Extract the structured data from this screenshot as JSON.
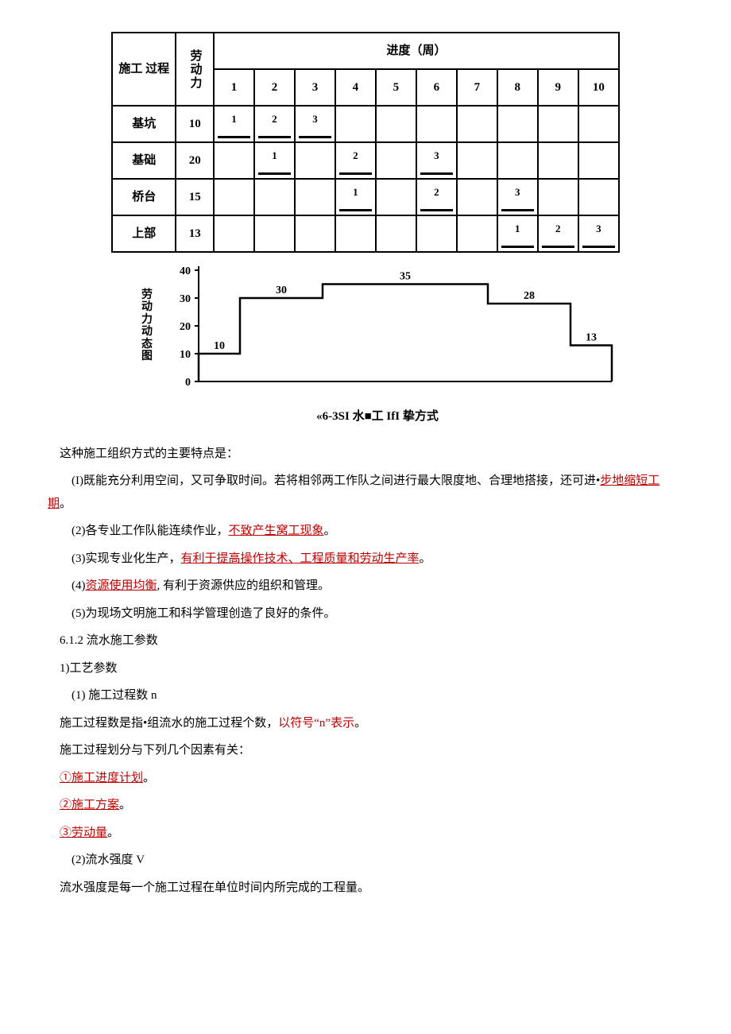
{
  "table": {
    "hdr_process": "施工\n过程",
    "hdr_labor": "劳动力",
    "hdr_progress": "进度（周）",
    "weeks": [
      "1",
      "2",
      "3",
      "4",
      "5",
      "6",
      "7",
      "8",
      "9",
      "10"
    ],
    "rows": [
      {
        "name": "基坑",
        "labor": "10",
        "bars": [
          [
            1,
            "1"
          ],
          [
            2,
            "2"
          ],
          [
            3,
            "3"
          ]
        ]
      },
      {
        "name": "基础",
        "labor": "20",
        "bars": [
          [
            2,
            "1"
          ],
          [
            4,
            "2"
          ],
          [
            6,
            "3"
          ]
        ]
      },
      {
        "name": "桥台",
        "labor": "15",
        "bars": [
          [
            4,
            "1"
          ],
          [
            6,
            "2"
          ],
          [
            8,
            "3"
          ]
        ]
      },
      {
        "name": "上部",
        "labor": "13",
        "bars": [
          [
            8,
            "1"
          ],
          [
            9,
            "2"
          ],
          [
            10,
            "3"
          ]
        ]
      }
    ]
  },
  "chart_data": {
    "type": "bar",
    "ylabel": "劳动力动态图",
    "y_ticks": [
      "40",
      "30",
      "20",
      "10",
      "0"
    ],
    "categories": [
      "1",
      "2",
      "3",
      "4",
      "5",
      "6",
      "7",
      "8",
      "9",
      "10"
    ],
    "values": [
      10,
      30,
      30,
      35,
      35,
      35,
      35,
      28,
      28,
      13
    ],
    "value_labels": {
      "10": "10",
      "30": "30",
      "35": "35",
      "28": "28",
      "13": "13"
    },
    "title": "",
    "ylim": [
      0,
      40
    ]
  },
  "caption": "«6-3SI 水■工 IfI 挚方式",
  "para0": "这种施工组织方式的主要特点是：",
  "para1_a": "(I)既能充分利用空间，又可争取时间。若将相邻两工作队之间进行最大限度地、合理地搭接，还可进•",
  "para1_b": "步地缩短工期",
  "para1_c": "。",
  "para2_a": "(2)各专业工作队能连续作业，",
  "para2_b": "不致产生窝工现象",
  "para2_c": "。",
  "para3_a": "(3)实现专业化生产，",
  "para3_b": "有利于提高操作技术、工程质量和劳动生产率",
  "para3_c": "。",
  "para4_a": "(4)",
  "para4_b": "资源使用均衡",
  "para4_c": ", 有利于资源供应的组织和管理。",
  "para5": "(5)为现场文明施工和科学管理创造了良好的条件。",
  "sec612": "6.1.2 流水施工参数",
  "sec1": "1)工艺参数",
  "sec1_1": "(1) 施工过程数 n",
  "sec1_1_p1a": "施工过程数是指•组流水的施工过程个数，",
  "sec1_1_p1b": "以符号“n”表示",
  "sec1_1_p1c": "。",
  "sec1_1_p2": "施工过程划分与下列几个因素有关：",
  "f1": "①施工进度计划",
  "f2": "②施工方案",
  "f3": "③劳动量",
  "dot": "。",
  "sec1_2": "(2)流水强度 V",
  "sec1_2_p": "流水强度是每一个施工过程在单位时间内所完成的工程量。"
}
